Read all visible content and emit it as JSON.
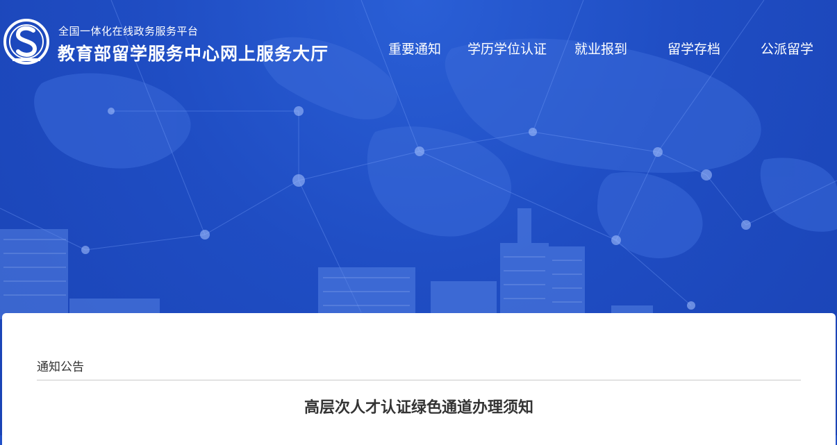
{
  "header": {
    "subtitle": "全国一体化在线政务服务平台",
    "title": "教育部留学服务中心网上服务大厅"
  },
  "nav": {
    "items": [
      {
        "label": "重要通知"
      },
      {
        "label": "学历学位认证"
      },
      {
        "label": "就业报到"
      },
      {
        "label": "留学存档"
      },
      {
        "label": "公派留学"
      }
    ]
  },
  "content": {
    "section_label": "通知公告",
    "article_title": "高层次人才认证绿色通道办理须知"
  },
  "colors": {
    "header_bg": "#1f4dc3",
    "panel_bg": "#ffffff",
    "text": "#333333"
  }
}
